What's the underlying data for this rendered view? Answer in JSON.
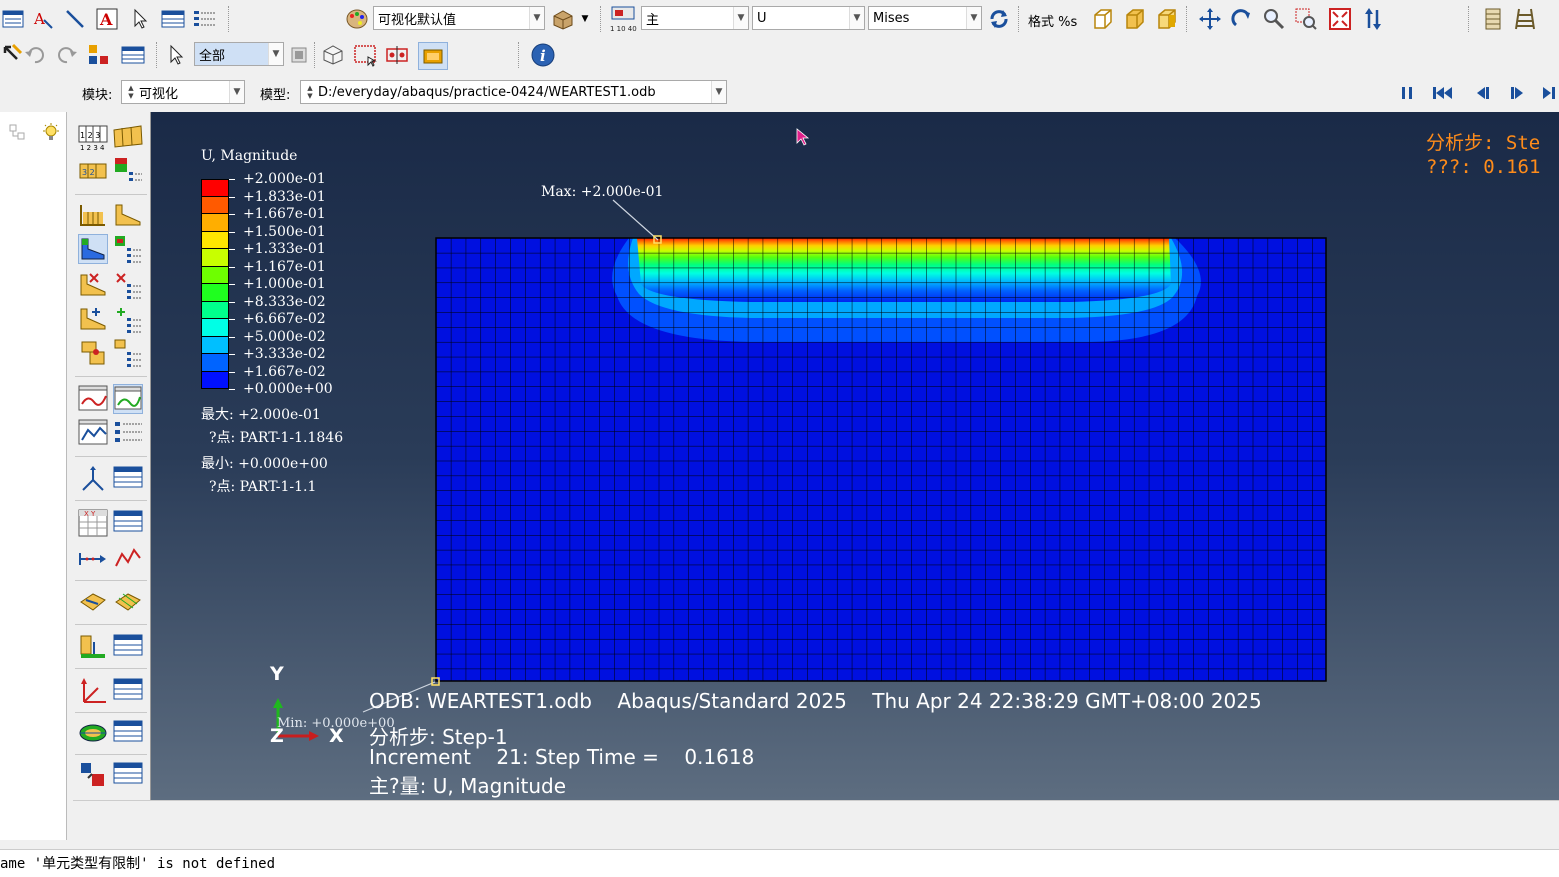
{
  "toolbar1": {
    "style_combo": "可视化默认值",
    "field_variable_combo": "主",
    "field_output_combo": "U",
    "invariant_combo": "Mises",
    "format_label": "格式 %s"
  },
  "toolbar2": {
    "selection_filter_combo": "全部"
  },
  "context_bar": {
    "module_label": "模块:",
    "module_value": "可视化",
    "model_label": "模型:",
    "model_value": "D:/everyday/abaqus/practice-0424/WEARTEST1.odb"
  },
  "legend": {
    "title": "U, Magnitude",
    "colors": [
      "#ff0000",
      "#ff5a00",
      "#ffae00",
      "#ffe600",
      "#c8ff00",
      "#6eff00",
      "#1fff1f",
      "#00ff8c",
      "#00ffe6",
      "#00bfff",
      "#0064ff",
      "#0010ff"
    ],
    "labels": [
      "+2.000e-01",
      "+1.833e-01",
      "+1.667e-01",
      "+1.500e-01",
      "+1.333e-01",
      "+1.167e-01",
      "+1.000e-01",
      "+8.333e-02",
      "+6.667e-02",
      "+5.000e-02",
      "+3.333e-02",
      "+1.667e-02",
      "+0.000e+00"
    ],
    "max_line": "最大: +2.000e-01",
    "max_node": "?点: PART-1-1.1846",
    "min_line": "最小: +0.000e+00",
    "min_node": "?点: PART-1-1.1"
  },
  "annotations": {
    "max_label": "Max: +2.000e-01",
    "min_label": "Min: +0.000e+00"
  },
  "triad": {
    "y": "Y",
    "z": "Z",
    "x": "X"
  },
  "step_info": {
    "line1": "分析步: Ste",
    "line2": "???: 0.161"
  },
  "odb_info": {
    "line1": "ODB: WEARTEST1.odb    Abaqus/Standard 2025    Thu Apr 24 22:38:29 GMT+08:00 2025",
    "line2": "分析步: Step-1",
    "line3": "Increment    21: Step Time =    0.1618",
    "line4": "主?量: U, Magnitude"
  },
  "message_area": {
    "text": "ame '单元类型有限制' is not defined"
  },
  "colors": {
    "mesh_base": "#0010e0",
    "grid_line": "#000000",
    "step_text": "#ff8c1a"
  }
}
